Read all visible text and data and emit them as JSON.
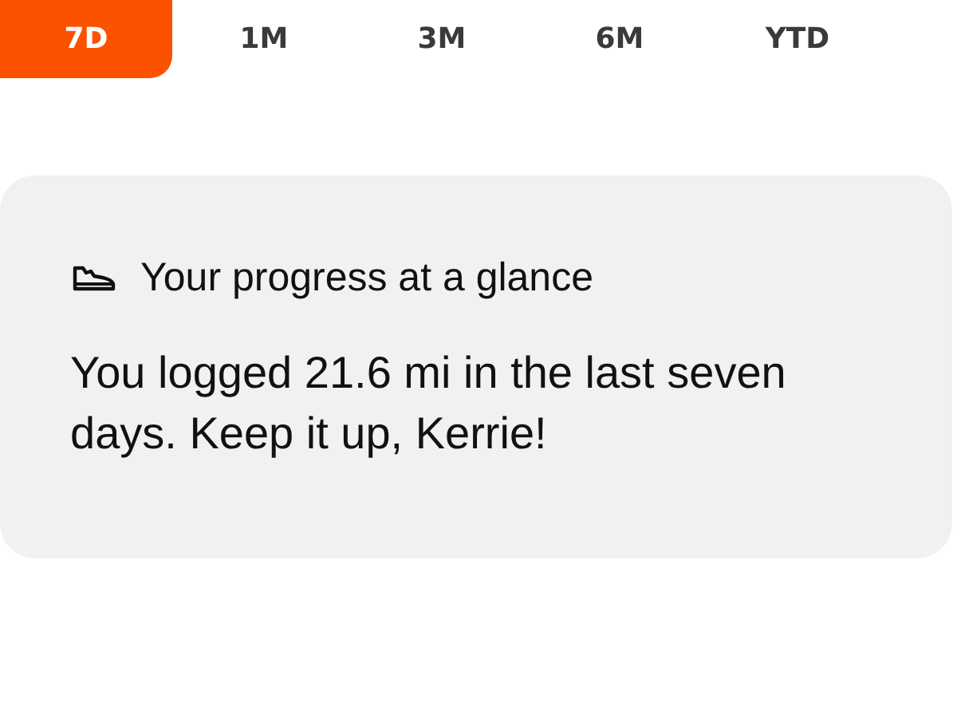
{
  "tabs": [
    {
      "label": "7D",
      "selected": true
    },
    {
      "label": "1M",
      "selected": false
    },
    {
      "label": "3M",
      "selected": false
    },
    {
      "label": "6M",
      "selected": false
    },
    {
      "label": "YTD",
      "selected": false
    }
  ],
  "card": {
    "title": "Your progress at a glance",
    "message": "You logged 21.6 mi in the last seven days. Keep it up, Kerrie!"
  }
}
